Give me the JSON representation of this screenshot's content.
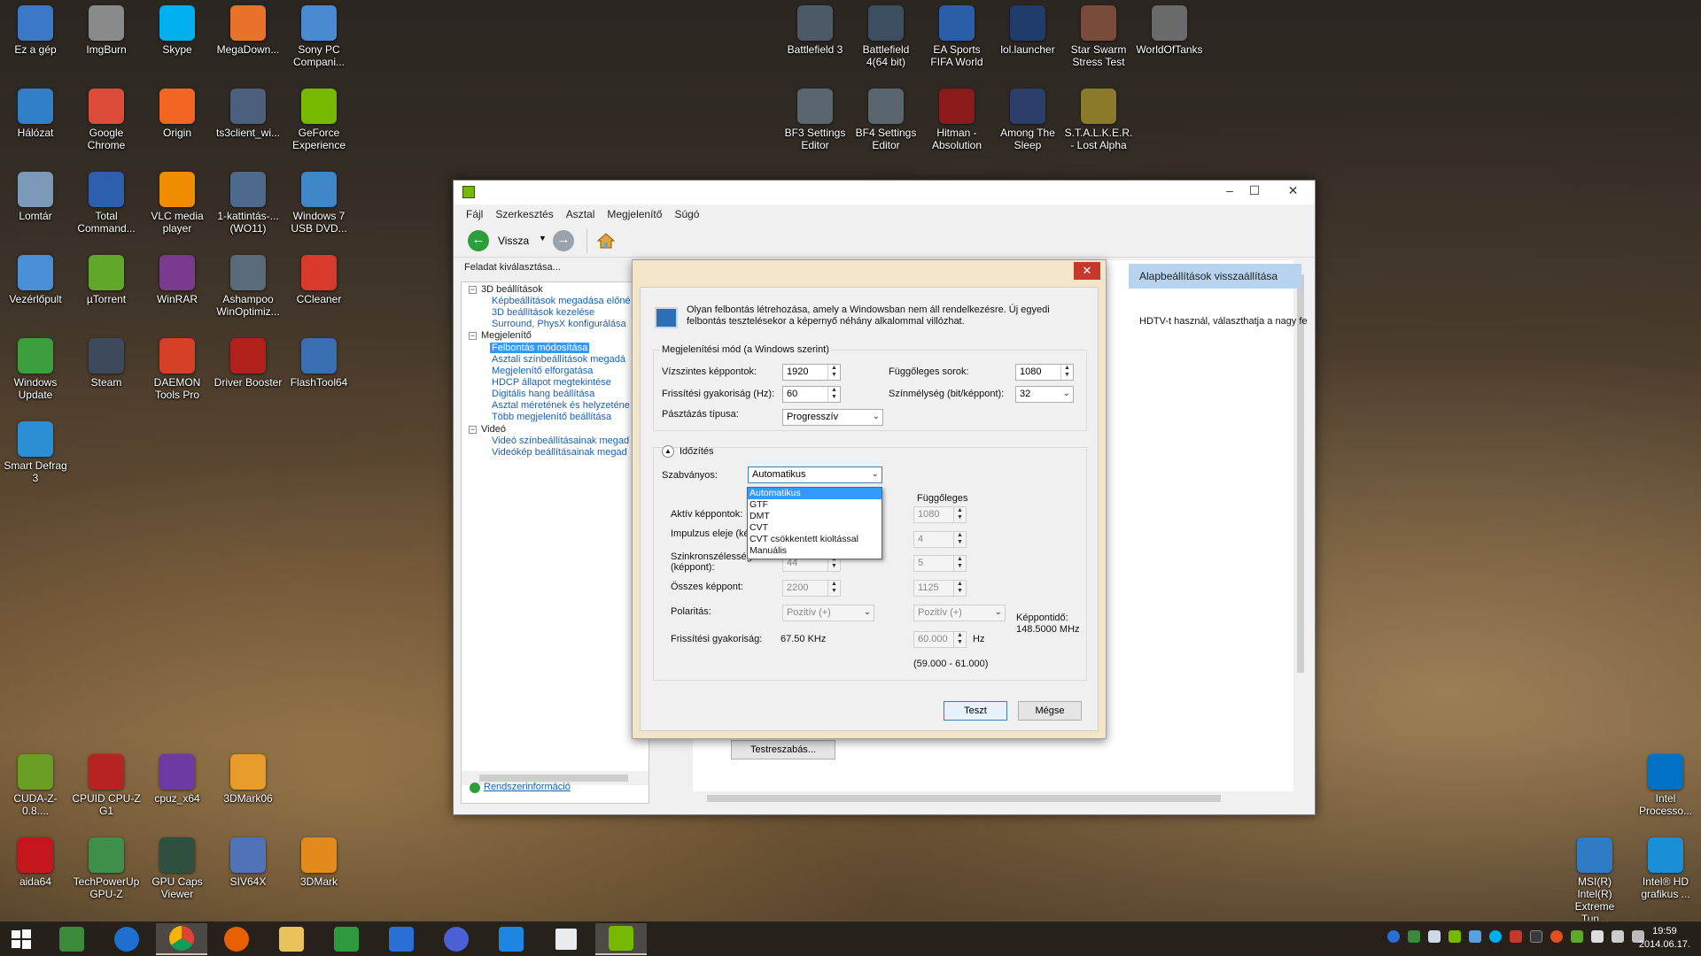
{
  "desktop": {
    "icons": [
      {
        "label": "Ez a gép",
        "color": "#3b78c8"
      },
      {
        "label": "ImgBurn",
        "color": "#8a8a8a"
      },
      {
        "label": "Skype",
        "color": "#00aff0"
      },
      {
        "label": "MegaDown...",
        "color": "#e8722a"
      },
      {
        "label": "Sony PC Compani...",
        "color": "#4a8ad0"
      },
      {
        "label": "Hálózat",
        "color": "#2f7fc9"
      },
      {
        "label": "Google Chrome",
        "color": "#dd4b39"
      },
      {
        "label": "Origin",
        "color": "#f26522"
      },
      {
        "label": "ts3client_wi...",
        "color": "#4c5f7c"
      },
      {
        "label": "GeForce Experience",
        "color": "#76b900"
      },
      {
        "label": "Lomtár",
        "color": "#7c9ab8"
      },
      {
        "label": "Total Command...",
        "color": "#2d5fae"
      },
      {
        "label": "VLC media player",
        "color": "#f08c00"
      },
      {
        "label": "1-kattintás-... (WO11)",
        "color": "#4d6a8c"
      },
      {
        "label": "Windows 7 USB DVD...",
        "color": "#3f86c9"
      },
      {
        "label": "Vezérlőpult",
        "color": "#4a90d9"
      },
      {
        "label": "µTorrent",
        "color": "#5fa82a"
      },
      {
        "label": "WinRAR",
        "color": "#7a3b8f"
      },
      {
        "label": "Ashampoo WinOptimiz...",
        "color": "#5c6b7a"
      },
      {
        "label": "CCleaner",
        "color": "#d93a2b"
      },
      {
        "label": "Windows Update",
        "color": "#3c9e3c"
      },
      {
        "label": "Steam",
        "color": "#3c4a5c"
      },
      {
        "label": "DAEMON Tools Pro",
        "color": "#d54027"
      },
      {
        "label": "Driver Booster",
        "color": "#b0211c"
      },
      {
        "label": "FlashTool64",
        "color": "#3a6fb2"
      },
      {
        "label": "Smart Defrag 3",
        "color": "#2a8fd4"
      },
      {
        "label": "CUDA-Z-0.8....",
        "color": "#6a9e24"
      },
      {
        "label": "CPUID CPU-Z G1",
        "color": "#b72323"
      },
      {
        "label": "cpuz_x64",
        "color": "#6d3aa4"
      },
      {
        "label": "3DMark06",
        "color": "#e79b2a"
      },
      {
        "label": "aida64",
        "color": "#c4161c"
      },
      {
        "label": "TechPowerUp GPU-Z",
        "color": "#3f8f4c"
      },
      {
        "label": "GPU Caps Viewer",
        "color": "#2f4f3f"
      },
      {
        "label": "SIV64X",
        "color": "#4e73b7"
      },
      {
        "label": "3DMark",
        "color": "#e38a1c"
      },
      {
        "label": "Battlefield 3",
        "color": "#4b5a66"
      },
      {
        "label": "Battlefield 4(64 bit)",
        "color": "#3c4f60"
      },
      {
        "label": "EA Sports FIFA World",
        "color": "#2a5ea8"
      },
      {
        "label": "lol.launcher",
        "color": "#1f3c6b"
      },
      {
        "label": "Star Swarm Stress Test",
        "color": "#7a4b3a"
      },
      {
        "label": "WorldOfTanks",
        "color": "#6a6a6a"
      },
      {
        "label": "BF3 Settings Editor",
        "color": "#59656f"
      },
      {
        "label": "BF4 Settings Editor",
        "color": "#59656f"
      },
      {
        "label": "Hitman - Absolution",
        "color": "#8b1a1a"
      },
      {
        "label": "Among The Sleep",
        "color": "#2b3f6a"
      },
      {
        "label": "S.T.A.L.K.E.R. - Lost Alpha",
        "color": "#8a7a2a"
      },
      {
        "label": "Intel Processo...",
        "color": "#0071c5"
      },
      {
        "label": "MSI(R) Intel(R) Extreme Tun...",
        "color": "#2f7bc6"
      },
      {
        "label": "Intel® HD grafikus ...",
        "color": "#1a8fd6"
      }
    ]
  },
  "window": {
    "minimize": "–",
    "maximize": "☐",
    "close": "✕",
    "menu": [
      "Fájl",
      "Szerkesztés",
      "Asztal",
      "Megjelenítő",
      "Súgó"
    ],
    "back_label": "Vissza",
    "task_header": "Feladat kiválasztása...",
    "tree": {
      "3d": "3D beállítások",
      "3d_items": [
        "Képbeállítások megadása előné",
        "3D beállítások kezelése",
        "Surround, PhysX konfigurálása"
      ],
      "display": "Megjelenítő",
      "display_items": [
        "Felbontás módosítása",
        "Asztali színbeállítások megadá",
        "Megjelenítő elforgatása",
        "HDCP állapot megtekintése",
        "Digitális hang beállítása",
        "Asztal méretének és helyzeténe",
        "Több megjelenítő beállítása"
      ],
      "video": "Videó",
      "video_items": [
        "Videó színbeállításainak megad",
        "Videókép beállításainak megad"
      ]
    },
    "system_info": "Rendszerinformáció",
    "restore_defaults": "Alapbeállítások visszaállítása",
    "right_text": "HDTV-t használ, választhatja a nagy fe",
    "customize_button": "Testreszabás..."
  },
  "dialog": {
    "close": "✕",
    "intro": "Olyan felbontás létrehozása, amely a Windowsban nem áll rendelkezésre. Új egyedi felbontás tesztelésekor a képernyő néhány alkalommal villózhat.",
    "mode_group": "Megjelenítési mód (a Windows szerint)",
    "horizontal_pixels_label": "Vízszintes képpontok:",
    "horizontal_pixels": "1920",
    "vertical_lines_label": "Függőleges sorok:",
    "vertical_lines": "1080",
    "refresh_label": "Frissítési gyakoriság (Hz):",
    "refresh": "60",
    "color_depth_label": "Színmélység (bit/képpont):",
    "color_depth": "32",
    "scan_type_label": "Pásztázás típusa:",
    "scan_type": "Progresszív",
    "timing_label": "Időzítés",
    "standard_label": "Szabványos:",
    "standard_value": "Automatikus",
    "standard_options": [
      "Automatikus",
      "GTF",
      "DMT",
      "CVT",
      "CVT csökkentett kioltással",
      "Manuális"
    ],
    "vertical_col": "Függőleges",
    "active_pixels_label": "Aktív képpontok:",
    "active_v": "1080",
    "front_porch_label": "Impulzus eleje (ké",
    "front_v": "4",
    "sync_width_label": "Szinkronszélesség",
    "sync_width_label2": "(képpont):",
    "sync_h": "44",
    "sync_v": "5",
    "total_label": "Összes képpont:",
    "total_h": "2200",
    "total_v": "1125",
    "polarity_label": "Polaritás:",
    "polarity_h": "Pozitív (+)",
    "polarity_v": "Pozitív (+)",
    "pixel_clock_label": "Képpontidő:",
    "pixel_clock": "148.5000 MHz",
    "refresh2_label": "Frissítési gyakoriság:",
    "refresh_khz": "67.50 KHz",
    "refresh_hz": "60.000",
    "hz_unit": "Hz",
    "refresh_range": "(59.000 - 61.000)",
    "test_button": "Teszt",
    "cancel_button": "Mégse"
  },
  "taskbar": {
    "time": "19:59",
    "date": "2014.06.17."
  }
}
